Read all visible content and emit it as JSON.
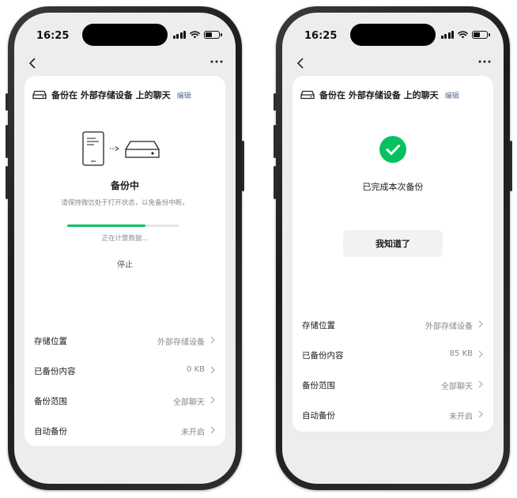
{
  "phones": [
    {
      "status_time": "16:25",
      "header_title": "备份在 外部存储设备 上的聊天",
      "edit_label": "编辑",
      "status_title": "备份中",
      "status_desc": "请保持微信处于打开状态，以免备份中断。",
      "progress": 0.7,
      "progress_text": "正在计算数据...",
      "stop_label": "停止",
      "rows": [
        {
          "label": "存储位置",
          "value": "外部存储设备"
        },
        {
          "label": "已备份内容",
          "value": "0 KB"
        },
        {
          "label": "备份范围",
          "value": "全部聊天"
        },
        {
          "label": "自动备份",
          "value": "未开启"
        }
      ]
    },
    {
      "status_time": "16:25",
      "header_title": "备份在 外部存储设备 上的聊天",
      "edit_label": "编辑",
      "done_text": "已完成本次备份",
      "ok_label": "我知道了",
      "rows": [
        {
          "label": "存储位置",
          "value": "外部存储设备"
        },
        {
          "label": "已备份内容",
          "value": "85 KB"
        },
        {
          "label": "备份范围",
          "value": "全部聊天"
        },
        {
          "label": "自动备份",
          "value": "未开启"
        }
      ]
    }
  ],
  "icons": {
    "back": "chevron-left-icon",
    "more": "ellipsis-icon",
    "drive": "hard-drive-icon",
    "phone": "phone-icon",
    "arrow": "arrow-right-icon",
    "check": "check-circle-icon",
    "chevron": "chevron-right-icon"
  },
  "colors": {
    "accent_green": "#07c160",
    "link_blue": "#576b95",
    "screen_bg": "#ededed"
  }
}
